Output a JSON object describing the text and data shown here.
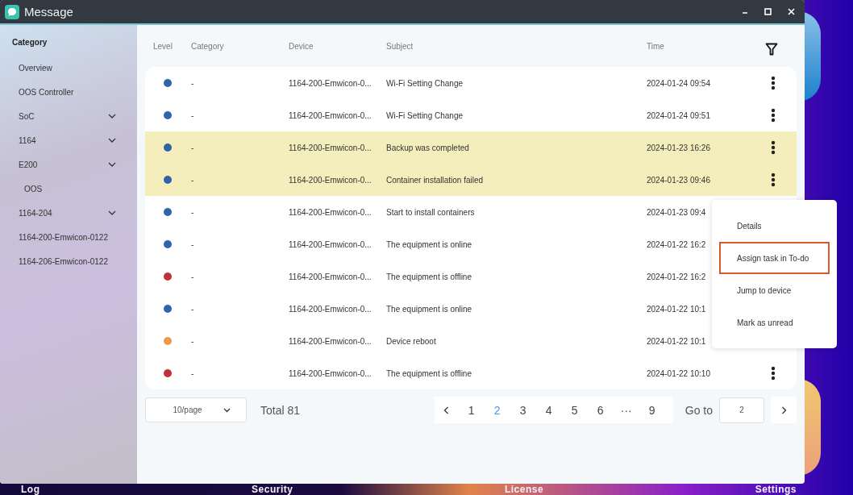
{
  "window": {
    "title": "Message"
  },
  "sidebar": {
    "heading": "Category",
    "items": [
      {
        "label": "Overview",
        "kind": "item"
      },
      {
        "label": "OOS Controller",
        "kind": "item"
      },
      {
        "label": "SoC",
        "kind": "group"
      },
      {
        "label": "1164",
        "kind": "group"
      },
      {
        "label": "E200",
        "kind": "group",
        "children": [
          {
            "label": "OOS",
            "kind": "item"
          }
        ]
      },
      {
        "label": "1164-204",
        "kind": "group"
      },
      {
        "label": "1164-200-Emwicon-0122",
        "kind": "item"
      },
      {
        "label": "1164-206-Emwicon-0122",
        "kind": "item"
      }
    ]
  },
  "table": {
    "columns": [
      "Level",
      "Category",
      "Device",
      "Subject",
      "Time"
    ],
    "rows": [
      {
        "color": "#2f64a8",
        "category": "-",
        "device": "1164-200-Emwicon-0...",
        "subject": "Wi-Fi Setting Change",
        "time": "2024-01-24 09:54",
        "highlighted": false
      },
      {
        "color": "#2f64a8",
        "category": "-",
        "device": "1164-200-Emwicon-0...",
        "subject": "Wi-Fi Setting Change",
        "time": "2024-01-24 09:51",
        "highlighted": false
      },
      {
        "color": "#2f64a8",
        "category": "-",
        "device": "1164-200-Emwicon-0...",
        "subject": "Backup was completed",
        "time": "2024-01-23 16:26",
        "highlighted": true
      },
      {
        "color": "#2f64a8",
        "category": "-",
        "device": "1164-200-Emwicon-0...",
        "subject": "Container installation failed",
        "time": "2024-01-23 09:46",
        "highlighted": true,
        "menu": {
          "items": [
            {
              "label": "Details",
              "selected": false
            },
            {
              "label": "Assign task in To-do",
              "selected": true
            },
            {
              "label": "Jump to device",
              "selected": false
            },
            {
              "label": "Mark as unread",
              "selected": false
            }
          ]
        }
      },
      {
        "color": "#2f64a8",
        "category": "-",
        "device": "1164-200-Emwicon-0...",
        "subject": "Start to install containers",
        "time": "2024-01-23 09:4",
        "highlighted": false
      },
      {
        "color": "#2f64a8",
        "category": "-",
        "device": "1164-200-Emwicon-0...",
        "subject": "The equipment is online",
        "time": "2024-01-22 16:2",
        "highlighted": false
      },
      {
        "color": "#c0303c",
        "category": "-",
        "device": "1164-200-Emwicon-0...",
        "subject": "The equipment is offline",
        "time": "2024-01-22 16:2",
        "highlighted": false
      },
      {
        "color": "#2f64a8",
        "category": "-",
        "device": "1164-200-Emwicon-0...",
        "subject": "The equipment is online",
        "time": "2024-01-22 10:1",
        "highlighted": false
      },
      {
        "color": "#f0994a",
        "category": "-",
        "device": "1164-200-Emwicon-0...",
        "subject": "Device reboot",
        "time": "2024-01-22 10:1",
        "highlighted": false
      },
      {
        "color": "#c0303c",
        "category": "-",
        "device": "1164-200-Emwicon-0...",
        "subject": "The equipment is offline",
        "time": "2024-01-22 10:10",
        "highlighted": false
      }
    ]
  },
  "pagination": {
    "page_size": "10/page",
    "total": "Total 81",
    "pages": [
      {
        "label": "1",
        "selected": false
      },
      {
        "label": "2",
        "selected": true
      },
      {
        "label": "3",
        "selected": false
      },
      {
        "label": "4",
        "selected": false
      },
      {
        "label": "5",
        "selected": false
      },
      {
        "label": "6",
        "selected": false
      },
      {
        "label": "···",
        "selected": false
      },
      {
        "label": "9",
        "selected": false
      }
    ],
    "goto_label": "Go to",
    "goto_value": "2"
  },
  "dock": [
    "Log",
    "Security",
    "License",
    "Settings"
  ]
}
